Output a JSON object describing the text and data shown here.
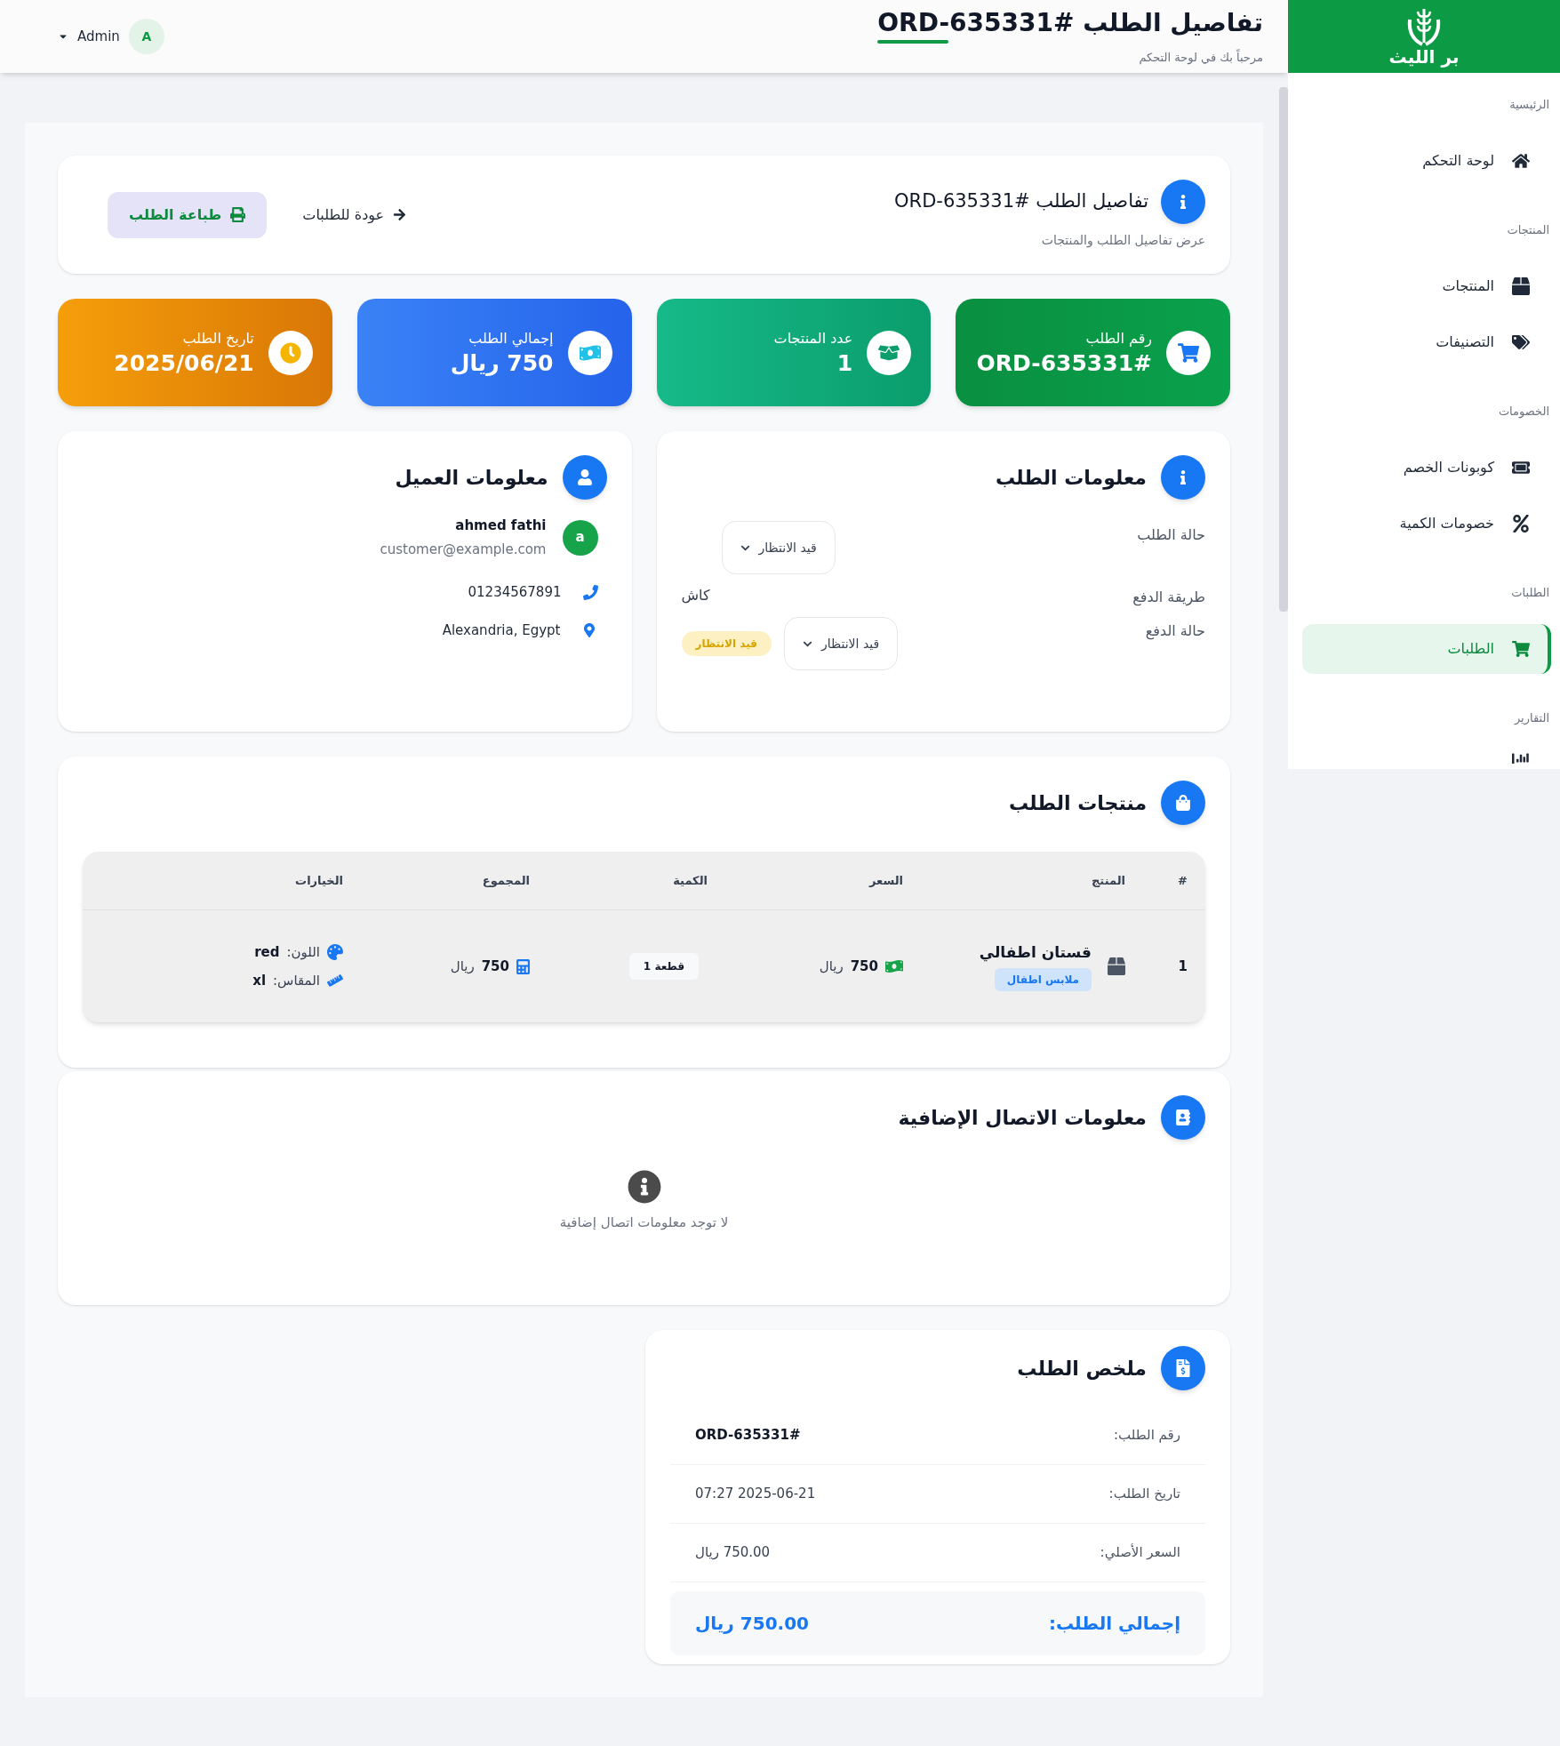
{
  "sidebar": {
    "logo_text": "بر الليث",
    "sections": [
      {
        "title": "الرئيسية",
        "items": [
          {
            "label": "لوحة التحكم",
            "selected": false
          }
        ]
      },
      {
        "title": "المنتجات",
        "items": [
          {
            "label": "المنتجات",
            "selected": false
          },
          {
            "label": "التصنيفات",
            "selected": false
          }
        ]
      },
      {
        "title": "الخصومات",
        "items": [
          {
            "label": "كوبونات الخصم",
            "selected": false
          },
          {
            "label": "خصومات الكمية",
            "selected": false
          }
        ]
      },
      {
        "title": "الطلبات",
        "items": [
          {
            "label": "الطلبات",
            "selected": true
          }
        ]
      },
      {
        "title": "التقارير"
      }
    ]
  },
  "header": {
    "title": "تفاصيل الطلب #ORD-635331",
    "subtitle": "مرحباً بك في لوحة التحكم",
    "user": "Admin",
    "avatar": "A"
  },
  "page_card": {
    "title": "تفاصيل الطلب #ORD-635331",
    "subtitle": "عرض تفاصيل الطلب والمنتجات",
    "back_link": "عودة للطلبات",
    "print_button": "طباعة الطلب"
  },
  "stats": [
    {
      "label": "رقم الطلب",
      "value": "#ORD-635331"
    },
    {
      "label": "عدد المنتجات",
      "value": "1"
    },
    {
      "label": "إجمالي الطلب",
      "value": "750 ريال"
    },
    {
      "label": "تاريخ الطلب",
      "value": "2025/06/21"
    }
  ],
  "order_info": {
    "title": "معلومات الطلب",
    "rows": [
      {
        "kind": "select",
        "label": "حالة الطلب",
        "value": "قيد الانتظار"
      },
      {
        "kind": "text",
        "label": "طريقة الدفع",
        "value": "كاش"
      },
      {
        "kind": "select_badge",
        "label": "حالة الدفع",
        "value": "قيد الانتظار",
        "badge": "قيد الانتظار"
      }
    ]
  },
  "customer": {
    "title": "معلومات العميل",
    "avatar": "a",
    "name": "ahmed fathi",
    "email": "customer@example.com",
    "phone": "01234567891",
    "address": "Alexandria, Egypt"
  },
  "products": {
    "title": "منتجات الطلب",
    "columns": [
      "#",
      "المنتج",
      "السعر",
      "الكمية",
      "المجموع",
      "الخيارات"
    ],
    "rows": [
      {
        "index": "1",
        "name": "قستان اطفالي",
        "category": "ملابس اطفال",
        "price": "750",
        "currency": "ريال",
        "quantity": "1 قطعة",
        "total": "750",
        "total_currency": "ريال",
        "options": [
          {
            "label": "اللون:",
            "value": "red"
          },
          {
            "label": "المقاس:",
            "value": "xl"
          }
        ]
      }
    ]
  },
  "contact": {
    "title": "معلومات الاتصال الإضافية",
    "empty_message": "لا توجد معلومات اتصال إضافية"
  },
  "summary": {
    "title": "ملخص الطلب",
    "rows": [
      {
        "label": "رقم الطلب:",
        "value": "#ORD-635331",
        "bold": true
      },
      {
        "label": "تاريخ الطلب:",
        "value": "2025-06-21 07:27",
        "bold": false
      },
      {
        "label": "السعر الأصلي:",
        "value": "750.00 ريال",
        "bold": false
      }
    ],
    "total_label": "إجمالي الطلب:",
    "total_value": "750.00 ريال"
  }
}
